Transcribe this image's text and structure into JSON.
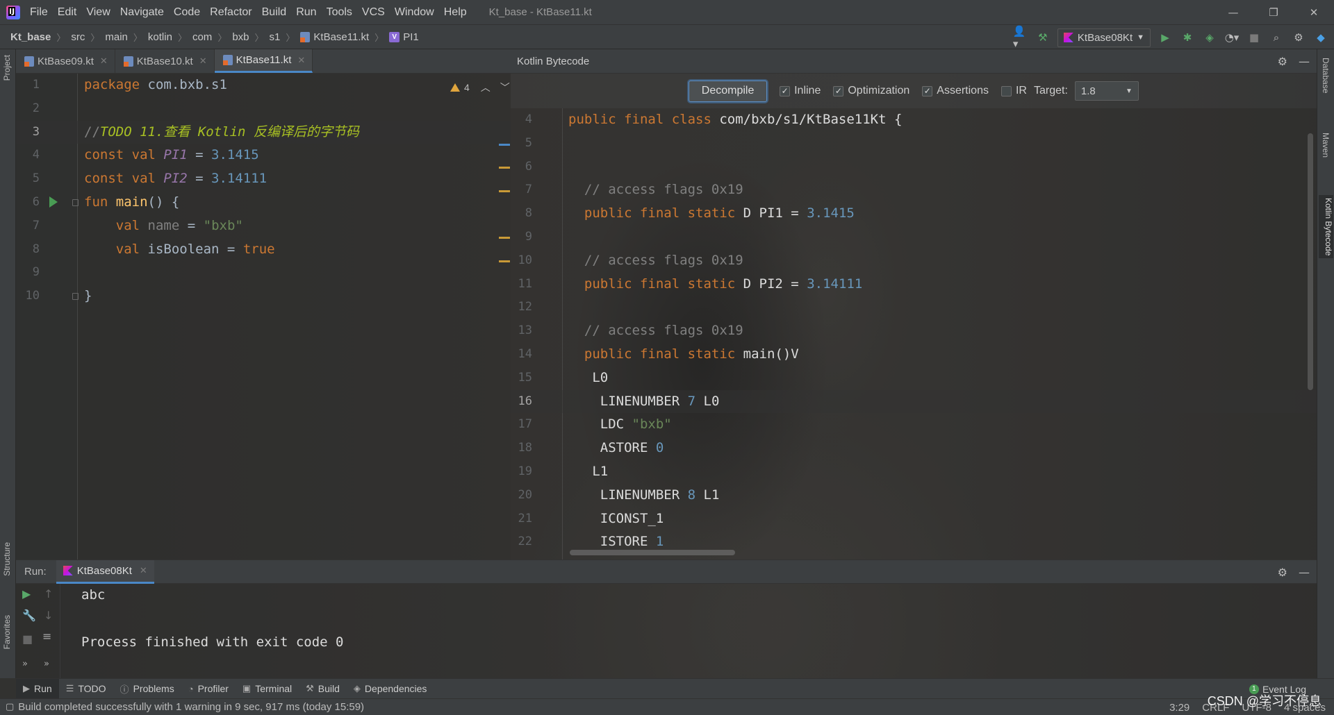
{
  "window": {
    "title": "Kt_base - KtBase11.kt",
    "menu": [
      "File",
      "Edit",
      "View",
      "Navigate",
      "Code",
      "Refactor",
      "Build",
      "Run",
      "Tools",
      "VCS",
      "Window",
      "Help"
    ]
  },
  "breadcrumb": [
    "Kt_base",
    "src",
    "main",
    "kotlin",
    "com",
    "bxb",
    "s1",
    "KtBase11.kt",
    "PI1"
  ],
  "toolbar": {
    "run_config": "KtBase08Kt"
  },
  "left_stripe": {
    "project": "Project",
    "structure": "Structure",
    "favorites": "Favorites"
  },
  "right_stripe": {
    "database": "Database",
    "maven": "Maven",
    "kotlin_bytecode": "Kotlin Bytecode"
  },
  "editor": {
    "tabs": [
      {
        "label": "KtBase09.kt",
        "active": false
      },
      {
        "label": "KtBase10.kt",
        "active": false
      },
      {
        "label": "KtBase11.kt",
        "active": true
      }
    ],
    "warnings": "4",
    "line_numbers": [
      "1",
      "2",
      "3",
      "4",
      "5",
      "6",
      "7",
      "8",
      "9",
      "10"
    ],
    "current_line": 3,
    "lines": [
      {
        "t1": "package",
        "t2": " com.bxb.s1"
      },
      {},
      {
        "comment": "//",
        "todo": "TODO 11.查看 Kotlin 反编译后的字节码"
      },
      {
        "kw": "const val ",
        "name": "PI1",
        "op": " = ",
        "num": "3.1415"
      },
      {
        "kw": "const val ",
        "name": "PI2",
        "op": " = ",
        "num": "3.14111"
      },
      {
        "kw": "fun ",
        "fn": "main",
        "rest": "() {"
      },
      {
        "indent": "    ",
        "kw": "val ",
        "name": "name",
        "op": " = ",
        "str": "\"bxb\""
      },
      {
        "indent": "    ",
        "kw": "val ",
        "name": "isBoolean",
        "op": " = ",
        "val": "true"
      },
      {},
      {
        "rest": "}"
      }
    ]
  },
  "bytecode": {
    "title": "Kotlin Bytecode",
    "decompile_label": "Decompile",
    "options": [
      {
        "label": "Inline",
        "checked": true
      },
      {
        "label": "Optimization",
        "checked": true
      },
      {
        "label": "Assertions",
        "checked": true
      },
      {
        "label": "IR",
        "checked": false
      }
    ],
    "target_label": "Target:",
    "target_value": "1.8",
    "line_numbers": [
      "4",
      "5",
      "6",
      "7",
      "8",
      "9",
      "10",
      "11",
      "12",
      "13",
      "14",
      "15",
      "16",
      "17",
      "18",
      "19",
      "20",
      "21",
      "22"
    ],
    "current_line": 16,
    "lines": [
      {
        "kw": "public final class",
        "rest": " com/bxb/s1/KtBase11Kt {"
      },
      {},
      {},
      {
        "indent": "  ",
        "cmt": "// access flags 0x19"
      },
      {
        "indent": "  ",
        "kw": "public final static",
        "rest": " D PI1 = ",
        "num": "3.1415"
      },
      {},
      {
        "indent": "  ",
        "cmt": "// access flags 0x19"
      },
      {
        "indent": "  ",
        "kw": "public final static",
        "rest": " D PI2 = ",
        "num": "3.14111"
      },
      {},
      {
        "indent": "  ",
        "cmt": "// access flags 0x19"
      },
      {
        "indent": "  ",
        "kw": "public final static",
        "rest": " main()V"
      },
      {
        "indent": "   ",
        "rest": "L0"
      },
      {
        "indent": "    ",
        "rest": "LINENUMBER ",
        "num": "7",
        "rest2": " L0"
      },
      {
        "indent": "    ",
        "rest": "LDC ",
        "str": "\"bxb\""
      },
      {
        "indent": "    ",
        "rest": "ASTORE ",
        "num": "0"
      },
      {
        "indent": "   ",
        "rest": "L1"
      },
      {
        "indent": "    ",
        "rest": "LINENUMBER ",
        "num": "8",
        "rest2": " L1"
      },
      {
        "indent": "    ",
        "rest": "ICONST_1"
      },
      {
        "indent": "    ",
        "rest": "ISTORE ",
        "num": "1"
      }
    ]
  },
  "run_panel": {
    "label": "Run:",
    "tab": "KtBase08Kt",
    "output": [
      "abc",
      "",
      "Process finished with exit code 0"
    ]
  },
  "bottom_tools": [
    "Run",
    "TODO",
    "Problems",
    "Profiler",
    "Terminal",
    "Build",
    "Dependencies"
  ],
  "event_log": {
    "label": "Event Log",
    "count": "1"
  },
  "status": {
    "message": "Build completed successfully with 1 warning in 9 sec, 917 ms (today 15:59)",
    "position": "3:29",
    "line_sep": "CRLF",
    "encoding": "UTF-8",
    "indent": "4 spaces"
  },
  "watermark": "CSDN @学习不停息",
  "colors": {
    "keyword": "#cc7832",
    "number": "#6897bb",
    "string": "#6a8759",
    "todo": "#a8c023",
    "accent": "#4a88c7"
  }
}
